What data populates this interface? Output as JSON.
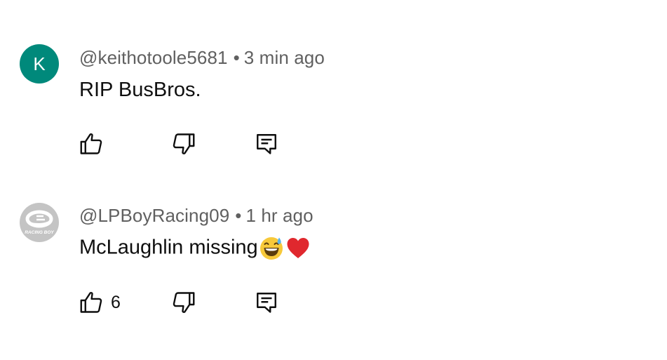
{
  "comments": [
    {
      "avatar_letter": "K",
      "avatar_color": "#00897b",
      "author": "@keithotoole5681",
      "separator": "•",
      "time": "3 min ago",
      "text": "RIP BusBros.",
      "emoji": [],
      "like_count": ""
    },
    {
      "avatar_logo_icon": "racing-boy-logo",
      "avatar_logo_text": "RACING BOY",
      "author": "@LPBoyRacing09",
      "separator": "•",
      "time": "1 hr ago",
      "text": "McLaughlin missing",
      "emoji": [
        "grinning-face-with-sweat-emoji",
        "red-heart-emoji"
      ],
      "like_count": "6"
    }
  ],
  "icons": {
    "like": "thumbs-up-icon",
    "dislike": "thumbs-down-icon",
    "reply": "reply-icon"
  },
  "colors": {
    "meta_text": "#606060",
    "body_text": "#0f0f0f"
  }
}
